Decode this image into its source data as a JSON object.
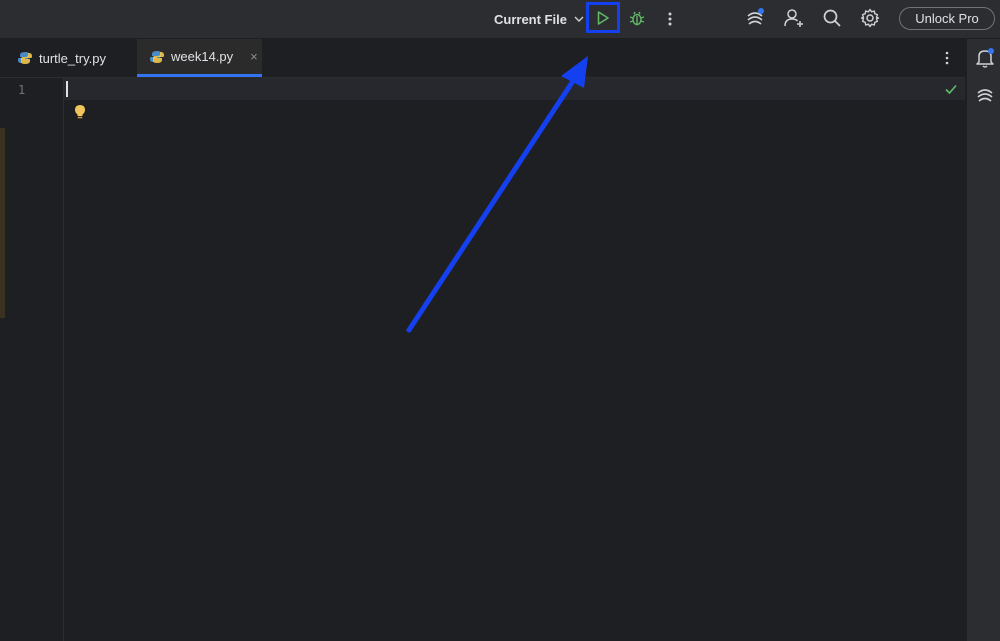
{
  "titlebar": {
    "run_config_label": "Current File",
    "unlock_label": "Unlock Pro",
    "icons": [
      "chevron-down-icon",
      "run-icon",
      "debug-bug-icon",
      "more-vertical-icon",
      "ai-assistant-icon",
      "add-user-icon",
      "search-icon",
      "gear-icon"
    ],
    "accent_color": "#1440f0"
  },
  "tabs": [
    {
      "label": "turtle_try.py",
      "active": false
    },
    {
      "label": "week14.py",
      "active": true,
      "close": "×"
    }
  ],
  "editor": {
    "line_numbers": [
      "1"
    ]
  },
  "colors": {
    "background": "#1e1f22",
    "run_green": "#5fb865",
    "active_tab_underline": "#3574f0",
    "notification_dot": "#3574f0"
  }
}
